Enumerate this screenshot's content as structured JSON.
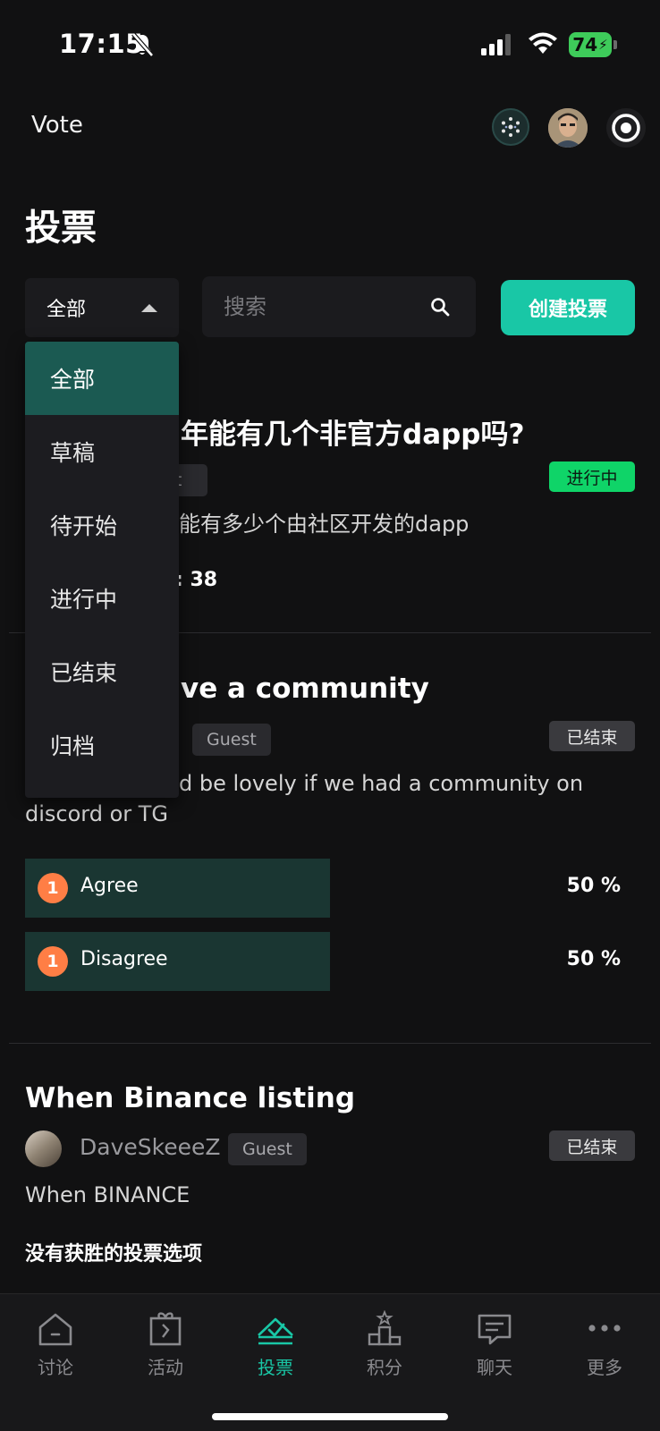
{
  "status_bar": {
    "time": "17:15",
    "battery": "74"
  },
  "header": {
    "app_title": "Vote"
  },
  "page": {
    "title": "投票"
  },
  "filter": {
    "selected": "全部",
    "options": [
      "全部",
      "草稿",
      "待开始",
      "进行中",
      "已结束",
      "归档"
    ]
  },
  "search": {
    "placeholder": "搜索"
  },
  "create_button": "创建投票",
  "polls": [
    {
      "title": "年能有几个非官方dapp吗?",
      "guest_partial": "st",
      "status": "进行中",
      "description": "能有多少个由社区开发的dapp",
      "timer_partial": ": 38"
    },
    {
      "title": "ve a community",
      "guest": "Guest",
      "status": "已结束",
      "description_line1": "d be lovely if we had a community on",
      "description_line2": "discord or TG",
      "options": [
        {
          "count": "1",
          "label": "Agree",
          "percent": "50 %",
          "share": 0.5
        },
        {
          "count": "1",
          "label": "Disagree",
          "percent": "50 %",
          "share": 0.5
        }
      ]
    },
    {
      "title": "When Binance listing",
      "author": "DaveSkeeeZ",
      "guest": "Guest",
      "status": "已结束",
      "description": "When BINANCE",
      "result_text": "没有获胜的投票选项"
    }
  ],
  "bottom_nav": [
    {
      "label": "讨论",
      "icon": "home-icon"
    },
    {
      "label": "活动",
      "icon": "gift-icon"
    },
    {
      "label": "投票",
      "icon": "vote-icon",
      "active": true
    },
    {
      "label": "积分",
      "icon": "podium-icon"
    },
    {
      "label": "聊天",
      "icon": "chat-icon"
    },
    {
      "label": "更多",
      "icon": "more-icon"
    }
  ],
  "colors": {
    "accent": "#19c7a6",
    "running": "#0fd468",
    "vote_count": "#ff7e45"
  }
}
